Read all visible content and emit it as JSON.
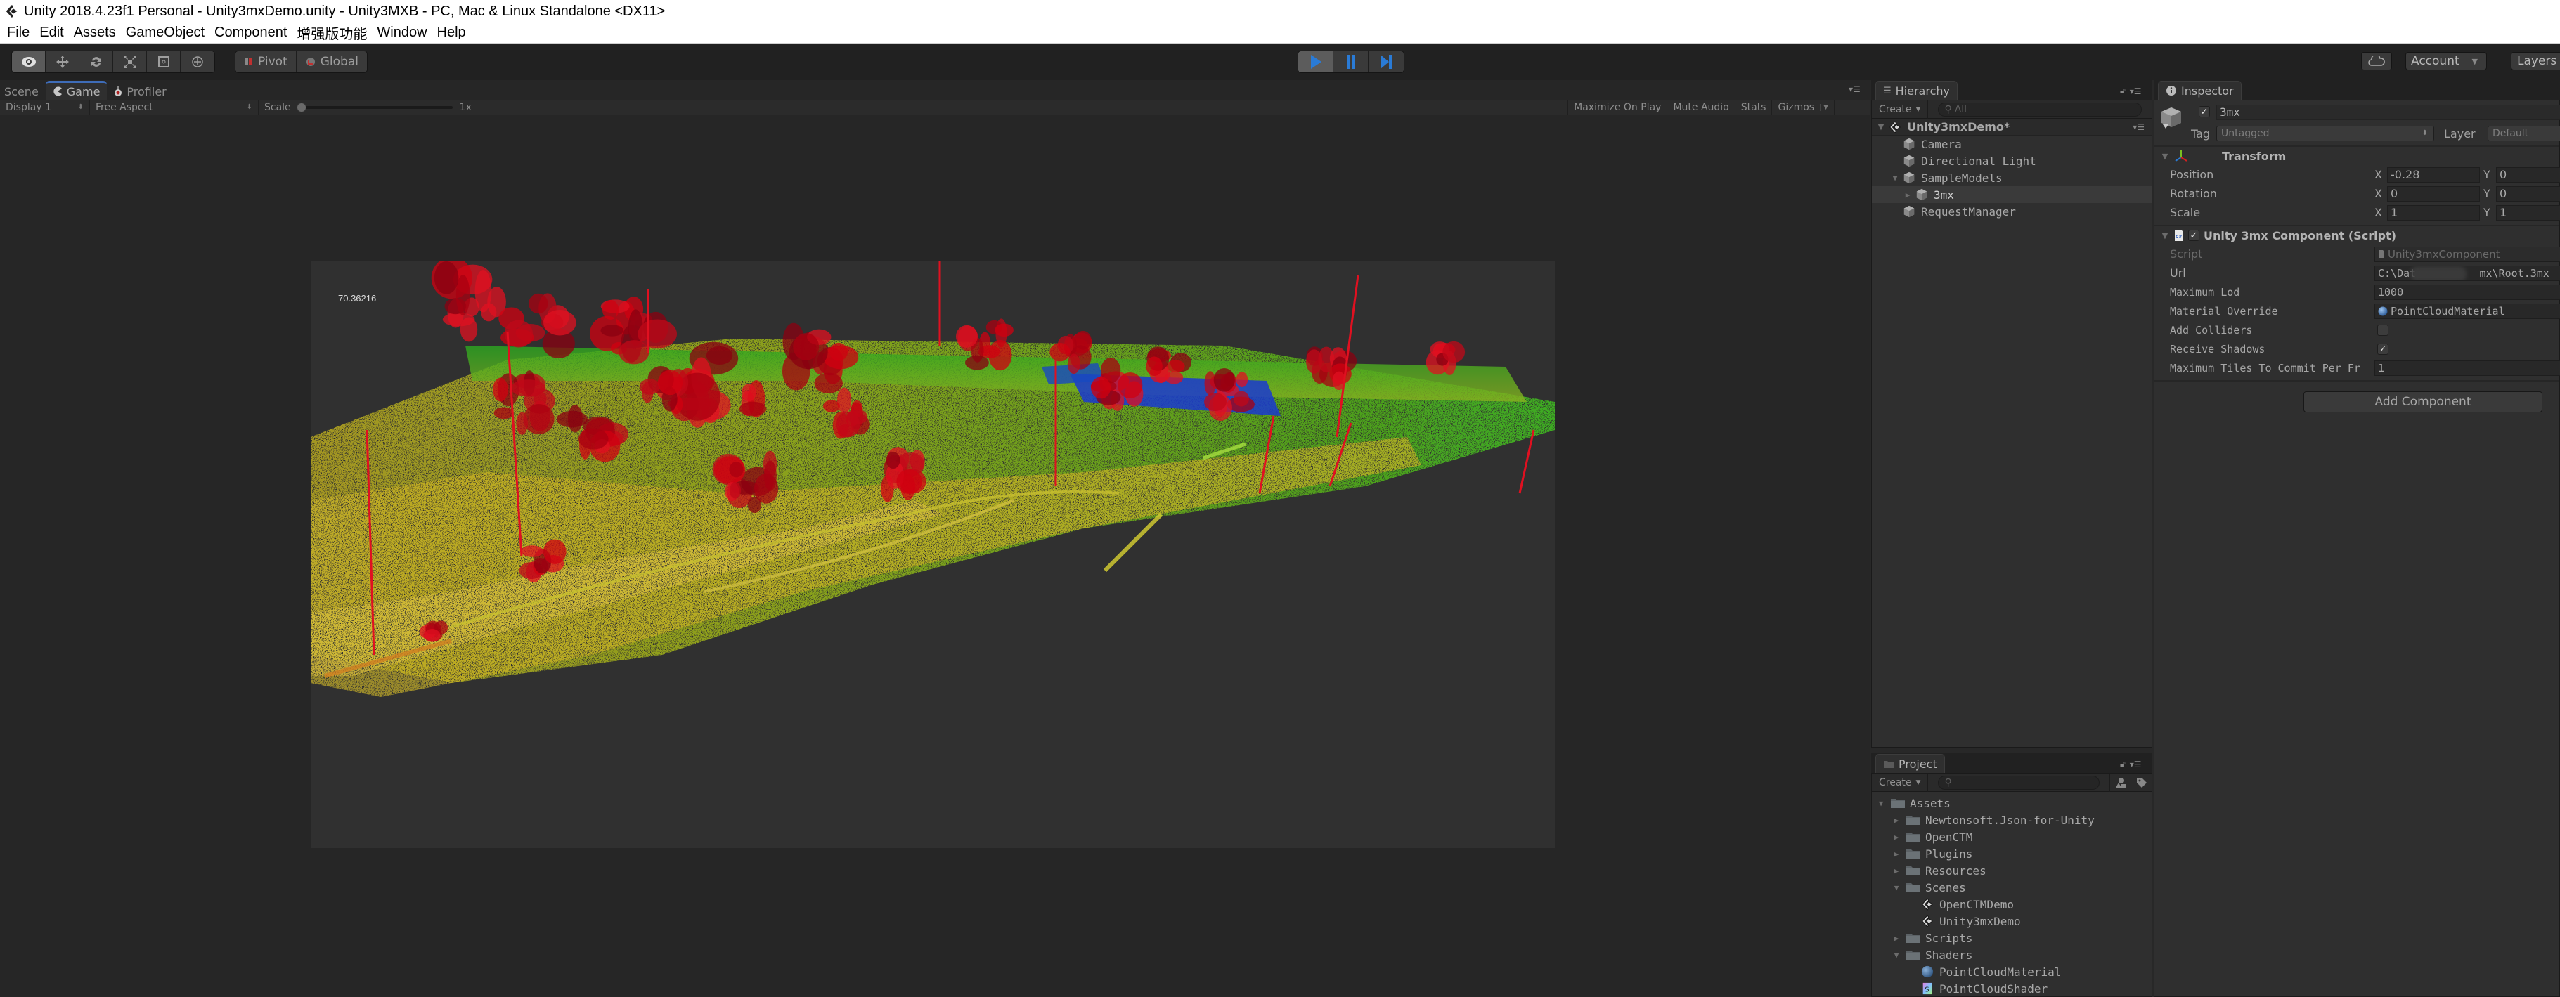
{
  "window": {
    "title": "Unity 2018.4.23f1 Personal - Unity3mxDemo.unity - Unity3MXB - PC, Mac & Linux Standalone <DX11>",
    "logo_icon": "unity-logo-icon"
  },
  "menu": [
    "File",
    "Edit",
    "Assets",
    "GameObject",
    "Component",
    "增强版功能",
    "Window",
    "Help"
  ],
  "toolbar": {
    "tools": [
      {
        "name": "view-tool",
        "icon": "eye-icon",
        "active": true
      },
      {
        "name": "move-tool",
        "icon": "move-arrows-icon",
        "active": false
      },
      {
        "name": "rotate-tool",
        "icon": "rotate-icon",
        "active": false
      },
      {
        "name": "scale-tool",
        "icon": "scale-icon",
        "active": false
      },
      {
        "name": "rect-tool",
        "icon": "rect-icon",
        "active": false
      },
      {
        "name": "transform-tool",
        "icon": "transform-icon",
        "active": false
      }
    ],
    "pivot_label": "Pivot",
    "global_label": "Global",
    "play_controls": [
      {
        "name": "play",
        "icon": "play-icon",
        "active": true
      },
      {
        "name": "pause",
        "icon": "pause-icon",
        "active": false
      },
      {
        "name": "step",
        "icon": "step-icon",
        "active": false
      }
    ],
    "accent_color": "#2a7bd6",
    "cloud_icon": "cloud-icon",
    "account_label": "Account",
    "layers_label": "Layers"
  },
  "game_panel": {
    "tabs": [
      {
        "label": "Scene",
        "icon": "",
        "active": false
      },
      {
        "label": "Game",
        "icon": "game-pacman-icon",
        "active": true
      },
      {
        "label": "Profiler",
        "icon": "profiler-icon",
        "active": false
      }
    ],
    "display_select": "Display 1",
    "aspect_select": "Free Aspect",
    "scale_label": "Scale",
    "scale_value": "1x",
    "scale_fraction": 0.0,
    "right_buttons": [
      "Maximize On Play",
      "Mute Audio",
      "Stats",
      "Gizmos"
    ],
    "overlay_text": "70.36216",
    "viewport_content": "LiDAR point cloud rendered with height-based color ramp (blue-green-yellow-red): road, trees, hedges and poles"
  },
  "hierarchy": {
    "tab_label": "Hierarchy",
    "create_label": "Create",
    "search_placeholder": "All",
    "scene_name": "Unity3mxDemo*",
    "items": [
      {
        "label": "Camera",
        "depth": 1,
        "expand": "none",
        "selected": false
      },
      {
        "label": "Directional Light",
        "depth": 1,
        "expand": "none",
        "selected": false
      },
      {
        "label": "SampleModels",
        "depth": 1,
        "expand": "expanded",
        "selected": false
      },
      {
        "label": "3mx",
        "depth": 2,
        "expand": "collapsed",
        "selected": true
      },
      {
        "label": "RequestManager",
        "depth": 1,
        "expand": "none",
        "selected": false
      }
    ]
  },
  "project": {
    "tab_label": "Project",
    "create_label": "Create",
    "search_placeholder": "",
    "items": [
      {
        "label": "Assets",
        "depth": 0,
        "type": "folder",
        "expand": "expanded",
        "bold": true
      },
      {
        "label": "Newtonsoft.Json-for-Unity",
        "depth": 1,
        "type": "folder",
        "expand": "collapsed"
      },
      {
        "label": "OpenCTM",
        "depth": 1,
        "type": "folder",
        "expand": "collapsed"
      },
      {
        "label": "Plugins",
        "depth": 1,
        "type": "folder",
        "expand": "collapsed"
      },
      {
        "label": "Resources",
        "depth": 1,
        "type": "folder",
        "expand": "collapsed"
      },
      {
        "label": "Scenes",
        "depth": 1,
        "type": "folder",
        "expand": "expanded"
      },
      {
        "label": "OpenCTMDemo",
        "depth": 2,
        "type": "scene",
        "expand": "none"
      },
      {
        "label": "Unity3mxDemo",
        "depth": 2,
        "type": "scene",
        "expand": "none"
      },
      {
        "label": "Scripts",
        "depth": 1,
        "type": "folder",
        "expand": "collapsed"
      },
      {
        "label": "Shaders",
        "depth": 1,
        "type": "folder",
        "expand": "expanded"
      },
      {
        "label": "PointCloudMaterial",
        "depth": 2,
        "type": "material",
        "expand": "none"
      },
      {
        "label": "PointCloudShader",
        "depth": 2,
        "type": "shader",
        "expand": "none"
      }
    ]
  },
  "inspector": {
    "tab_label": "Inspector",
    "object_active": true,
    "object_name": "3mx",
    "tag_label": "Tag",
    "tag_value": "Untagged",
    "layer_label": "Layer",
    "layer_value": "Default",
    "transform": {
      "title": "Transform",
      "rows": [
        {
          "label": "Position",
          "x": "-0.28",
          "y": "0"
        },
        {
          "label": "Rotation",
          "x": "0",
          "y": "0"
        },
        {
          "label": "Scale",
          "x": "1",
          "y": "1"
        }
      ]
    },
    "component": {
      "title": "Unity 3mx Component (Script)",
      "enabled": true,
      "script_label": "Script",
      "script_value": "Unity3mxComponent",
      "url_label": "Url",
      "url_value": "C:\\Dat          mx\\Root.3mx",
      "max_lod_label": "Maximum Lod",
      "max_lod_value": "1000",
      "material_label": "Material Override",
      "material_value": "PointCloudMaterial",
      "colliders_label": "Add Colliders",
      "colliders_checked": false,
      "shadows_label": "Receive Shadows",
      "shadows_checked": true,
      "tiles_label": "Maximum Tiles To Commit Per Fr",
      "tiles_value": "1"
    },
    "add_component_label": "Add Component"
  },
  "axis_labels": {
    "x": "X",
    "y": "Y"
  }
}
